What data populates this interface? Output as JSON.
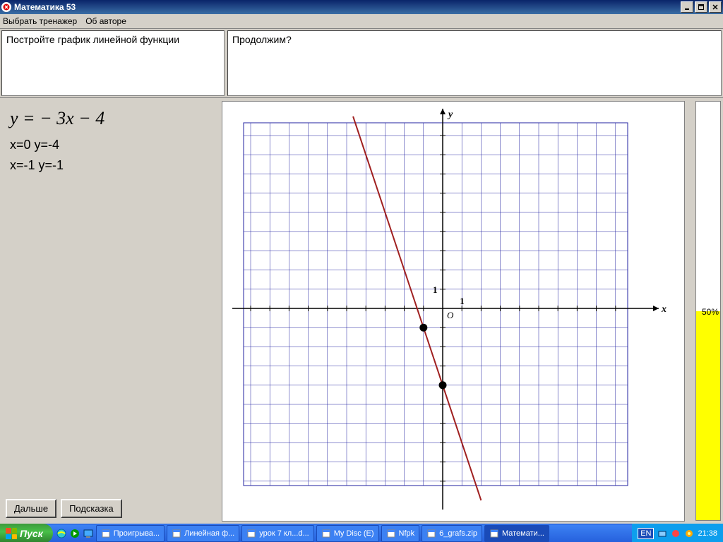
{
  "window": {
    "title": "Математика 53"
  },
  "menu": {
    "choose": "Выбрать тренажер",
    "about": "Об авторе"
  },
  "task": {
    "instruction": "Постройте график линейной функции",
    "prompt": "Продолжим?"
  },
  "formula": "y = − 3x − 4",
  "points": {
    "p1": "x=0   y=-4",
    "p2": "x=-1   y=-1"
  },
  "buttons": {
    "next": "Дальше",
    "hint": "Подсказка"
  },
  "progress": {
    "label": "50%",
    "percent": 50
  },
  "chart_data": {
    "type": "line",
    "title": "",
    "xlabel": "x",
    "ylabel": "y",
    "xlim": [
      -10,
      10
    ],
    "ylim": [
      -10,
      10
    ],
    "grid": true,
    "axis_labels": {
      "x": "x",
      "y": "y",
      "origin": "O",
      "unit_x": "1",
      "unit_y": "1"
    },
    "series": [
      {
        "name": "y = -3x - 4",
        "x": [
          -4.67,
          2
        ],
        "values": [
          10,
          -10
        ],
        "color": "#a02020"
      }
    ],
    "marked_points": [
      {
        "x": 0,
        "y": -4
      },
      {
        "x": -1,
        "y": -1
      }
    ]
  },
  "taskbar": {
    "start": "Пуск",
    "items": [
      {
        "label": "Проигрыва..."
      },
      {
        "label": "Линейная ф..."
      },
      {
        "label": "урок 7 кл...d..."
      },
      {
        "label": "My Disc (E)"
      },
      {
        "label": "Nfpk"
      },
      {
        "label": "6_grafs.zip"
      },
      {
        "label": "Математи...",
        "active": true
      }
    ],
    "lang": "EN",
    "clock": "21:38"
  }
}
